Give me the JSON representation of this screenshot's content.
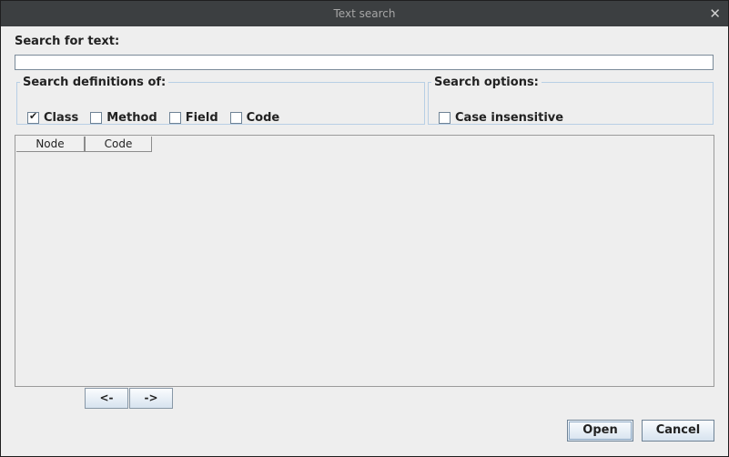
{
  "window": {
    "title": "Text search",
    "close_glyph": "✕",
    "close_icon": "close-icon"
  },
  "search": {
    "label": "Search for text:",
    "value": "",
    "placeholder": ""
  },
  "definitions": {
    "legend": "Search definitions of:",
    "items": [
      {
        "label": "Class",
        "checked": true
      },
      {
        "label": "Method",
        "checked": false
      },
      {
        "label": "Field",
        "checked": false
      },
      {
        "label": "Code",
        "checked": false
      }
    ]
  },
  "options": {
    "legend": "Search options:",
    "items": [
      {
        "label": "Case insensitive",
        "checked": false
      }
    ]
  },
  "results": {
    "columns": [
      "Node",
      "Code"
    ],
    "rows": []
  },
  "pager": {
    "prev_label": "<-",
    "next_label": "->"
  },
  "actions": {
    "open_label": "Open",
    "cancel_label": "Cancel"
  },
  "colors": {
    "titlebar": "#3c3f41",
    "panel": "#eeeeee",
    "group_border": "#b8cfe5"
  }
}
